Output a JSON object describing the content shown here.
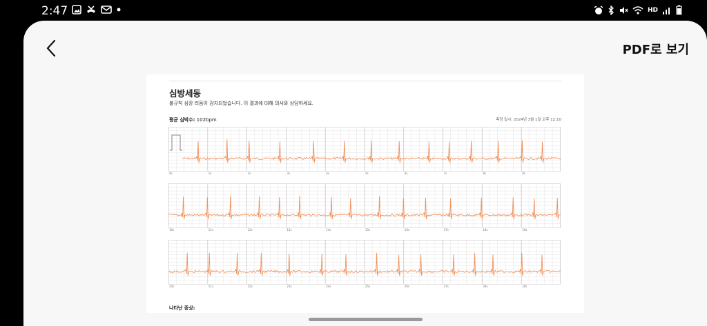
{
  "status_bar": {
    "time": "2:47",
    "left_icons": [
      "gallery-icon",
      "missed-call-icon",
      "mail-icon",
      "dot-icon"
    ],
    "right_icons": [
      "alarm-icon",
      "bluetooth-icon",
      "mute-icon",
      "wifi-icon",
      "hd-voice-icon",
      "signal-icon",
      "battery-icon"
    ],
    "hd_label": "HD"
  },
  "header": {
    "back_icon": "chevron-left-icon",
    "pdf_label": "PDF로 보기"
  },
  "report": {
    "title": "심방세동",
    "subtitle": "불규칙 심장 리듬이 감지되었습니다. 이 결과에 대해 의사와 상담하세요.",
    "heart_rate_label": "평균 심박수:",
    "heart_rate_value": "102bpm",
    "measured_at": "측정 일시: 2024년 3월 1일 오후 12:10",
    "symptoms_label": "나타난 증상:",
    "strips": [
      {
        "ticks": [
          "0s",
          "1s",
          "2s",
          "3s",
          "4s",
          "5s",
          "6s",
          "7s",
          "8s",
          "9s"
        ]
      },
      {
        "ticks": [
          "10s",
          "11s",
          "12s",
          "13s",
          "14s",
          "15s",
          "16s",
          "17s",
          "18s",
          "19s"
        ]
      },
      {
        "ticks": [
          "20s",
          "21s",
          "22s",
          "23s",
          "24s",
          "25s",
          "26s",
          "27s",
          "28s",
          "29s"
        ]
      }
    ],
    "colors": {
      "trace": "#f0905a",
      "grid": "#d9d9d9"
    }
  }
}
